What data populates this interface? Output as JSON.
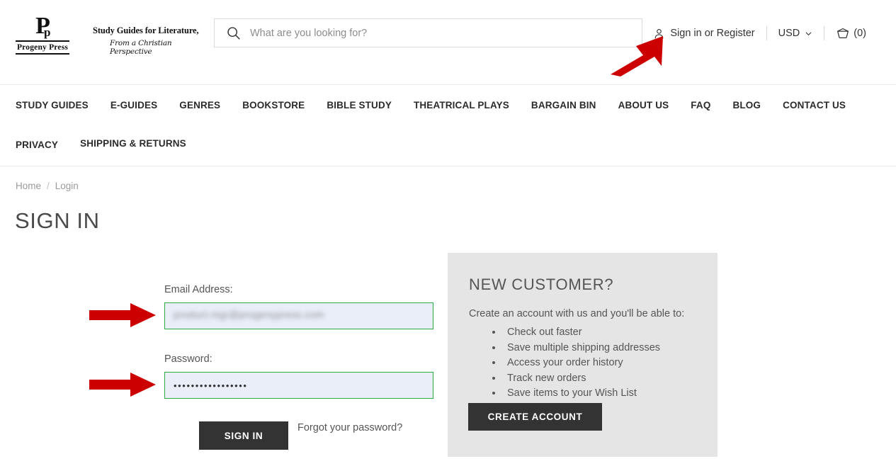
{
  "header": {
    "logo": {
      "monogram_big": "P",
      "monogram_small": "p",
      "name": "Progeny Press"
    },
    "tagline_line1": "Study Guides for Literature,",
    "tagline_line2": "From a Christian Perspective",
    "search": {
      "placeholder": "What are you looking for?",
      "value": "",
      "icon": "search-icon"
    },
    "account": {
      "icon": "user-icon",
      "label": "Sign in or Register"
    },
    "currency": {
      "label": "USD",
      "icon": "chevron-down-icon"
    },
    "cart": {
      "icon": "shopping-basket-icon",
      "count_label": "(0)"
    }
  },
  "nav": {
    "items": [
      {
        "label": "STUDY GUIDES"
      },
      {
        "label": "E-GUIDES"
      },
      {
        "label": "GENRES"
      },
      {
        "label": "BOOKSTORE"
      },
      {
        "label": "BIBLE STUDY"
      },
      {
        "label": "THEATRICAL PLAYS"
      },
      {
        "label": "BARGAIN BIN"
      },
      {
        "label": "ABOUT US"
      },
      {
        "label": "FAQ"
      },
      {
        "label": "BLOG"
      },
      {
        "label": "CONTACT US"
      },
      {
        "label": "PRIVACY"
      },
      {
        "label": "SHIPPING & RETURNS"
      }
    ]
  },
  "breadcrumb": {
    "home": "Home",
    "separator": "/",
    "current": "Login"
  },
  "page_title": "SIGN IN",
  "login_form": {
    "email_label": "Email Address:",
    "email_value": "product.mgr@progenypress.com",
    "email_placeholder": "",
    "password_label": "Password:",
    "password_value": "•••••••••••••••••",
    "password_placeholder": "",
    "submit_label": "SIGN IN",
    "forgot_label": "Forgot your password?"
  },
  "new_customer": {
    "title": "NEW CUSTOMER?",
    "lead": "Create an account with us and you'll be able to:",
    "benefits": [
      "Check out faster",
      "Save multiple shipping addresses",
      "Access your order history",
      "Track new orders",
      "Save items to your Wish List"
    ],
    "create_label": "CREATE ACCOUNT"
  },
  "annotations": {
    "arrows": [
      {
        "name": "arrow-to-sign-in-link",
        "direction": "up-right"
      },
      {
        "name": "arrow-to-email-field",
        "direction": "right"
      },
      {
        "name": "arrow-to-password-field",
        "direction": "right"
      }
    ],
    "color": "#cc0000"
  },
  "colors": {
    "accent_button": "#333333",
    "field_border_valid": "#2eaa43",
    "field_background": "#e9eef8",
    "panel_background": "#e5e5e5",
    "annotation_red": "#cc0000"
  }
}
